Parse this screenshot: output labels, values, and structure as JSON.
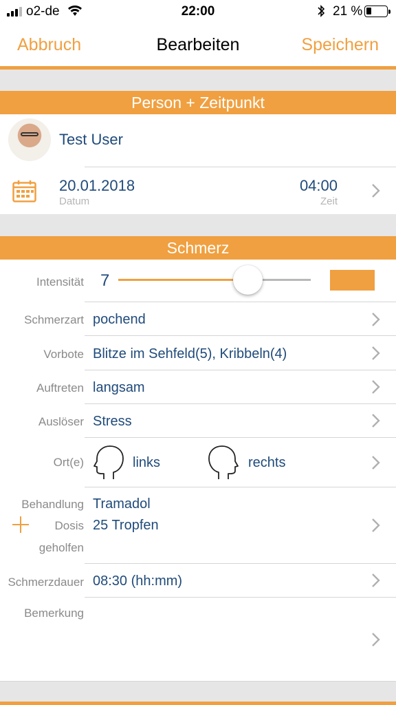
{
  "status_bar": {
    "carrier": "o2-de",
    "time": "22:00",
    "battery_percent": "21 %"
  },
  "nav": {
    "cancel": "Abbruch",
    "title": "Bearbeiten",
    "save": "Speichern"
  },
  "person_section": {
    "header": "Person + Zeitpunkt",
    "user_name": "Test User",
    "date": "20.01.2018",
    "date_label": "Datum",
    "time": "04:00",
    "time_label": "Zeit"
  },
  "pain_section": {
    "header": "Schmerz",
    "intensity_label": "Intensität",
    "intensity_value": "7",
    "intensity_fraction": 0.67,
    "intensity_color": "#f0a040",
    "type_label": "Schmerzart",
    "type_value": "pochend",
    "aura_label": "Vorbote",
    "aura_value": "Blitze im Sehfeld(5), Kribbeln(4)",
    "onset_label": "Auftreten",
    "onset_value": "langsam",
    "trigger_label": "Auslöser",
    "trigger_value": "Stress",
    "location_label": "Ort(e)",
    "location_left": "links",
    "location_right": "rechts",
    "treatment_label": "Behandlung",
    "treatment_value": "Tramadol",
    "dose_label": "Dosis",
    "dose_value": "25 Tropfen",
    "helped_label": "geholfen",
    "duration_label": "Schmerzdauer",
    "duration_value": "08:30 (hh:mm)",
    "remark_label": "Bemerkung"
  },
  "colors": {
    "accent": "#f0a040",
    "value_text": "#1f4a7a",
    "label_text": "#8a8a8a",
    "section_gap": "#e6e6e6"
  },
  "icons": [
    "signal-icon",
    "wifi-icon",
    "bluetooth-icon",
    "battery-icon",
    "calendar-icon",
    "chevron-right-icon",
    "head-left-icon",
    "head-right-icon",
    "plus-icon"
  ]
}
